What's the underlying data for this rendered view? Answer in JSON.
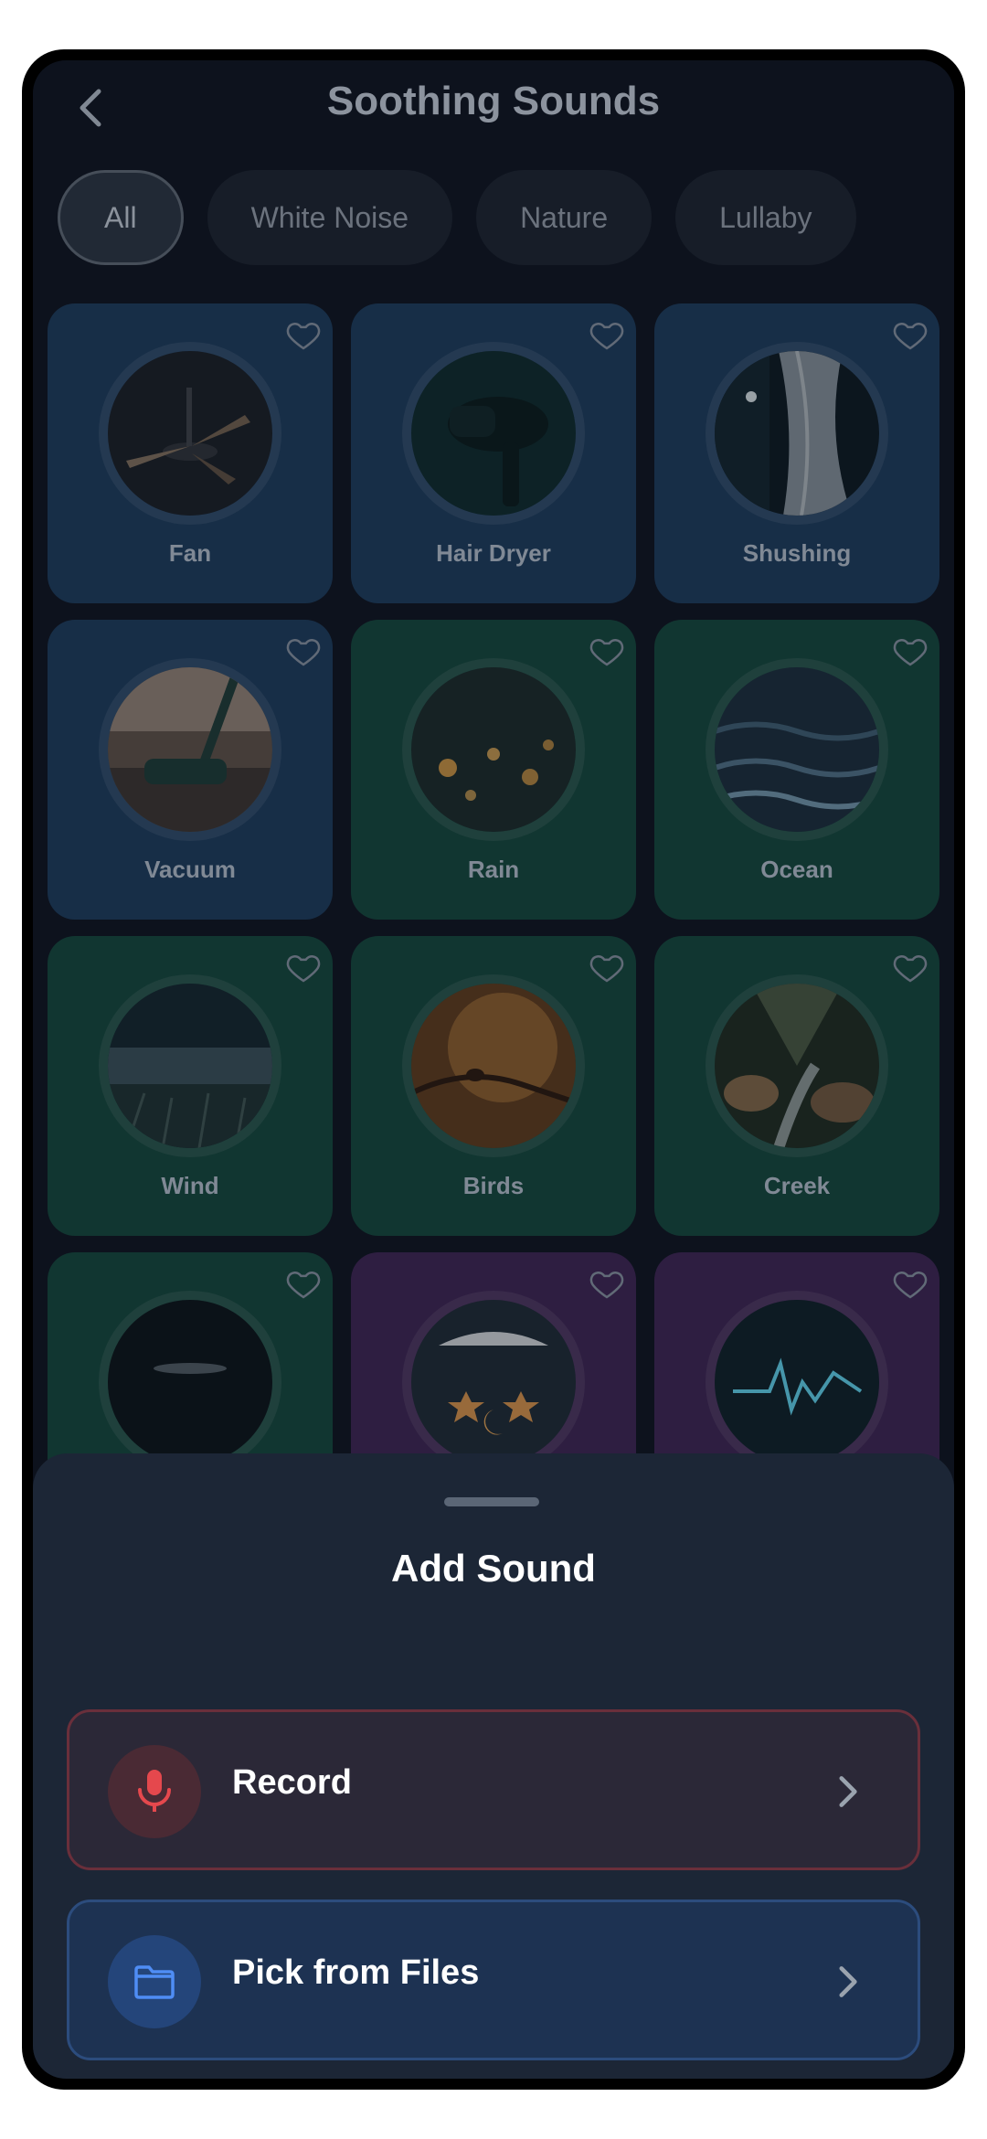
{
  "header": {
    "title": "Soothing Sounds",
    "back_icon": "chevron-left-icon"
  },
  "filters": {
    "chips": [
      "All",
      "White Noise",
      "Nature",
      "Lullaby"
    ],
    "active": "All"
  },
  "sounds": [
    {
      "label": "Fan",
      "category": "White Noise",
      "color": "#1d3a59"
    },
    {
      "label": "Hair Dryer",
      "category": "White Noise",
      "color": "#1d3a59"
    },
    {
      "label": "Shushing",
      "category": "White Noise",
      "color": "#1d3a59"
    },
    {
      "label": "Vacuum",
      "category": "White Noise",
      "color": "#1d3a59"
    },
    {
      "label": "Rain",
      "category": "Nature",
      "color": "#15443b"
    },
    {
      "label": "Ocean",
      "category": "Nature",
      "color": "#15443b"
    },
    {
      "label": "Wind",
      "category": "Nature",
      "color": "#15443b"
    },
    {
      "label": "Birds",
      "category": "Nature",
      "color": "#15443b"
    },
    {
      "label": "Creek",
      "category": "Nature",
      "color": "#15443b"
    },
    {
      "label": "",
      "category": "Nature",
      "color": "#15443b"
    },
    {
      "label": "",
      "category": "Lullaby",
      "color": "#3b2450"
    },
    {
      "label": "",
      "category": "Lullaby",
      "color": "#3b2450"
    }
  ],
  "sheet": {
    "title": "Add Sound",
    "options": [
      {
        "label": "Record",
        "icon": "microphone-icon",
        "accent": "#e5484d"
      },
      {
        "label": "Pick from Files",
        "icon": "folder-icon",
        "accent": "#4f8df5"
      }
    ]
  }
}
